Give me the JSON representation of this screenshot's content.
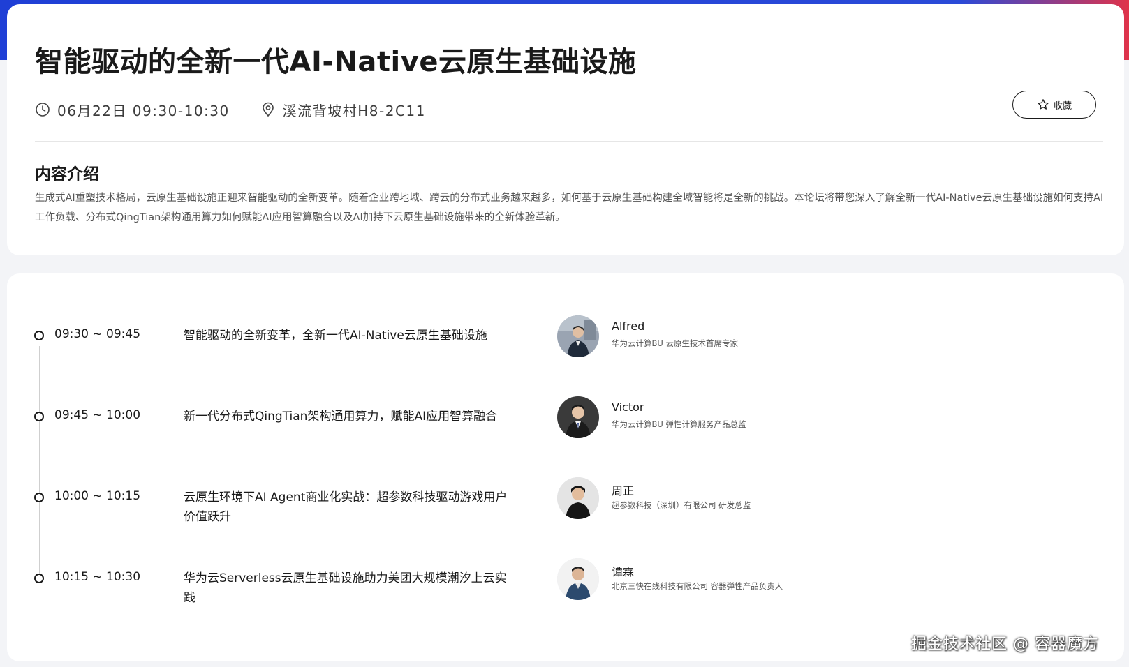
{
  "session": {
    "title": "智能驱动的全新一代AI-Native云原生基础设施",
    "datetime": "06月22日 09:30-10:30",
    "location": "溪流背坡村H8-2C11",
    "favorite_label": "收藏"
  },
  "intro": {
    "heading": "内容介绍",
    "text": "生成式AI重塑技术格局，云原生基础设施正迎来智能驱动的全新变革。随着企业跨地域、跨云的分布式业务越来越多，如何基于云原生基础构建全域智能将是全新的挑战。本论坛将带您深入了解全新一代AI-Native云原生基础设施如何支持AI工作负载、分布式QingTian架构通用算力如何赋能AI应用智算融合以及AI加持下云原生基础设施带来的全新体验革新。"
  },
  "agenda": [
    {
      "time": "09:30 ~ 09:45",
      "topic": "智能驱动的全新变革，全新一代AI-Native云原生基础设施",
      "speaker": "Alfred",
      "speaker_title": "华为云计算BU 云原生技术首席专家"
    },
    {
      "time": "09:45 ~ 10:00",
      "topic": "新一代分布式QingTian架构通用算力，赋能AI应用智算融合",
      "speaker": "Victor",
      "speaker_title": "华为云计算BU 弹性计算服务产品总监"
    },
    {
      "time": "10:00 ~ 10:15",
      "topic": "云原生环境下AI Agent商业化实战：超参数科技驱动游戏用户价值跃升",
      "speaker": "周正",
      "speaker_title": "超参数科技（深圳）有限公司 研发总监"
    },
    {
      "time": "10:15 ~ 10:30",
      "topic": "华为云Serverless云原生基础设施助力美团大规模潮汐上云实践",
      "speaker": "谭霖",
      "speaker_title": "北京三快在线科技有限公司 容器弹性产品负责人"
    }
  ],
  "watermark": "掘金技术社区 @ 容器魔方",
  "icons": {
    "clock": "clock-icon",
    "location": "location-pin-icon",
    "favorite": "star-outline-icon"
  },
  "colors": {
    "brand_blue": "#1f3fd6",
    "accent_red": "#e0334a"
  }
}
